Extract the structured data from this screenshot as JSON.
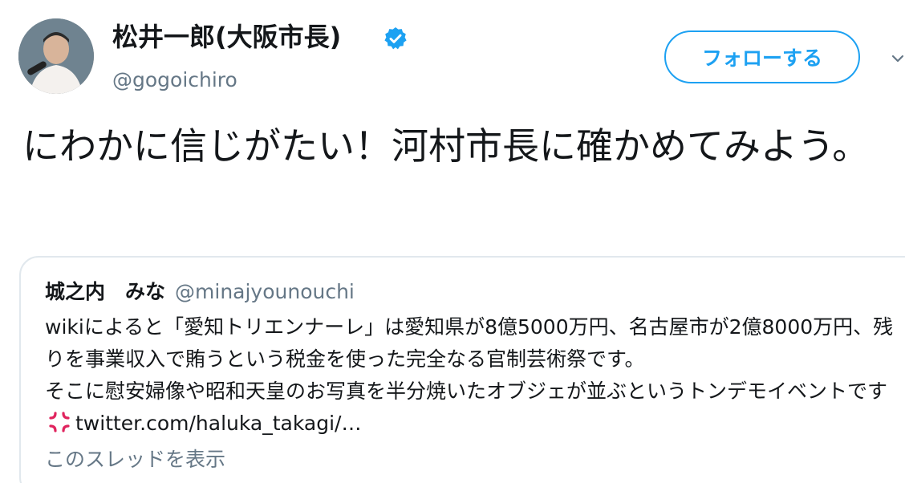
{
  "author": {
    "display_name": "松井一郎(大阪市長)",
    "handle": "@gogoichiro",
    "verified": true,
    "avatar_icon": "user-avatar"
  },
  "follow_button": {
    "label": "フォローする"
  },
  "tweet": {
    "text": "にわかに信じがたい！河村市長に確かめてみよう。"
  },
  "quoted_tweet": {
    "display_name": "城之内　みな",
    "handle": "@minajyounouchi",
    "text_line_1": "wikiによると「愛知トリエンナーレ」は愛知県が8億5000万円、名古屋市が2億8000万円、残りを事業収入で賄うという税金を使った完全なる官制芸術祭です。",
    "text_line_2": "そこに慰安婦像や昭和天皇のお写真を半分焼いたオブジェが並ぶというトンデモイベントです",
    "emoji_icon": "anger-symbol-icon",
    "link_text": "twitter.com/haluka_takagi/…"
  },
  "thread_link": {
    "label": "このスレッドを表示"
  },
  "colors": {
    "accent": "#1da1f2",
    "secondary_text": "#657786",
    "border": "#e1e8ed",
    "anger": "#e0245e"
  }
}
